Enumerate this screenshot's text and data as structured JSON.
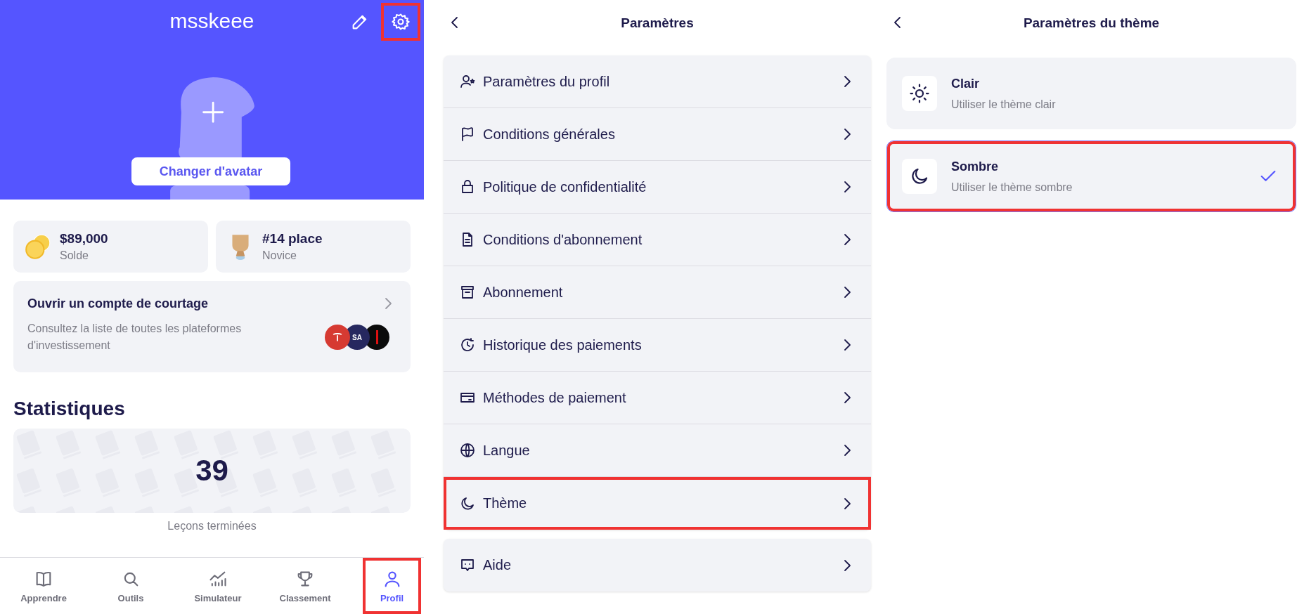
{
  "profile": {
    "username": "msskeee",
    "header_actions": [
      {
        "kind": "edit",
        "highlighted": false
      },
      {
        "kind": "settings",
        "highlighted": true
      }
    ],
    "avatar_button": "Changer d'avatar",
    "stats": [
      {
        "kind": "coins",
        "value": "$89,000",
        "label": "Solde"
      },
      {
        "kind": "trophy",
        "value": "#14 place",
        "label": "Novice"
      }
    ],
    "broker_card": {
      "title": "Ouvrir un compte de courtage",
      "description": "Consultez la liste de toutes les plateformes d'investissement",
      "logos": [
        {
          "kind": "tesla",
          "color": "#d63a32"
        },
        {
          "kind": "text",
          "text": "SA",
          "color": "#26285f"
        },
        {
          "kind": "bar",
          "color": "#0b0b0b"
        }
      ]
    },
    "statistics": {
      "heading": "Statistiques",
      "value": "39",
      "label": "Leçons terminées"
    },
    "nav": [
      {
        "kind": "book",
        "label": "Apprendre",
        "selected": false,
        "highlighted": false
      },
      {
        "kind": "search",
        "label": "Outils",
        "selected": false,
        "highlighted": false
      },
      {
        "kind": "chart",
        "label": "Simulateur",
        "selected": false,
        "highlighted": false
      },
      {
        "kind": "trophy",
        "label": "Classement",
        "selected": false,
        "highlighted": false
      },
      {
        "kind": "user",
        "label": "Profil",
        "selected": true,
        "highlighted": true
      }
    ]
  },
  "settings": {
    "title": "Paramètres",
    "groups": [
      [
        {
          "kind": "userstar",
          "label": "Paramètres du profil",
          "highlighted": false
        },
        {
          "kind": "flag",
          "label": "Conditions générales",
          "highlighted": false
        },
        {
          "kind": "lock",
          "label": "Politique de confidentialité",
          "highlighted": false
        },
        {
          "kind": "doc",
          "label": "Conditions d'abonnement",
          "highlighted": false
        },
        {
          "kind": "archive",
          "label": "Abonnement",
          "highlighted": false
        },
        {
          "kind": "history",
          "label": "Historique des paiements",
          "highlighted": false
        },
        {
          "kind": "card",
          "label": "Méthodes de paiement",
          "highlighted": false
        },
        {
          "kind": "globe",
          "label": "Langue",
          "highlighted": false
        },
        {
          "kind": "moon",
          "label": "Thème",
          "highlighted": true
        }
      ],
      [
        {
          "kind": "chat",
          "label": "Aide",
          "highlighted": false
        }
      ]
    ]
  },
  "theme": {
    "title": "Paramètres du thème",
    "options": [
      {
        "kind": "sun",
        "title": "Clair",
        "subtitle": "Utiliser le thème clair",
        "selected": false,
        "highlighted": false
      },
      {
        "kind": "moon",
        "title": "Sombre",
        "subtitle": "Utiliser le thème sombre",
        "selected": true,
        "highlighted": true
      }
    ]
  }
}
